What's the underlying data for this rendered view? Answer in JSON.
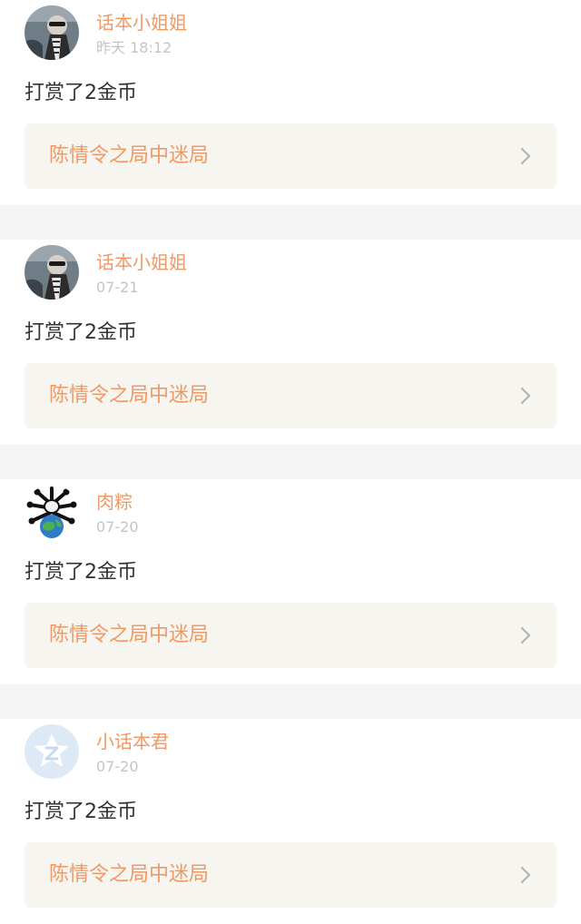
{
  "feed": {
    "items": [
      {
        "user": "话本小姐姐",
        "time": "昨天 18:12",
        "action": "打赏了2金币",
        "work_title": "陈情令之局中迷局",
        "avatar_icon": "sunglasses-person-avatar"
      },
      {
        "user": "话本小姐姐",
        "time": "07-21",
        "action": "打赏了2金币",
        "work_title": "陈情令之局中迷局",
        "avatar_icon": "sunglasses-person-avatar"
      },
      {
        "user": "肉粽",
        "time": "07-20",
        "action": "打赏了2金币",
        "work_title": "陈情令之局中迷局",
        "avatar_icon": "cartoon-globe-avatar"
      },
      {
        "user": "小话本君",
        "time": "07-20",
        "action": "打赏了2金币",
        "work_title": "陈情令之局中迷局",
        "avatar_icon": "default-star-avatar"
      }
    ]
  },
  "colors": {
    "accent": "#ee9966",
    "meta_text": "#c4c4c4",
    "body_text": "#333333",
    "link_card_bg": "#f6f5ef",
    "page_bg": "#f5f5f5"
  }
}
